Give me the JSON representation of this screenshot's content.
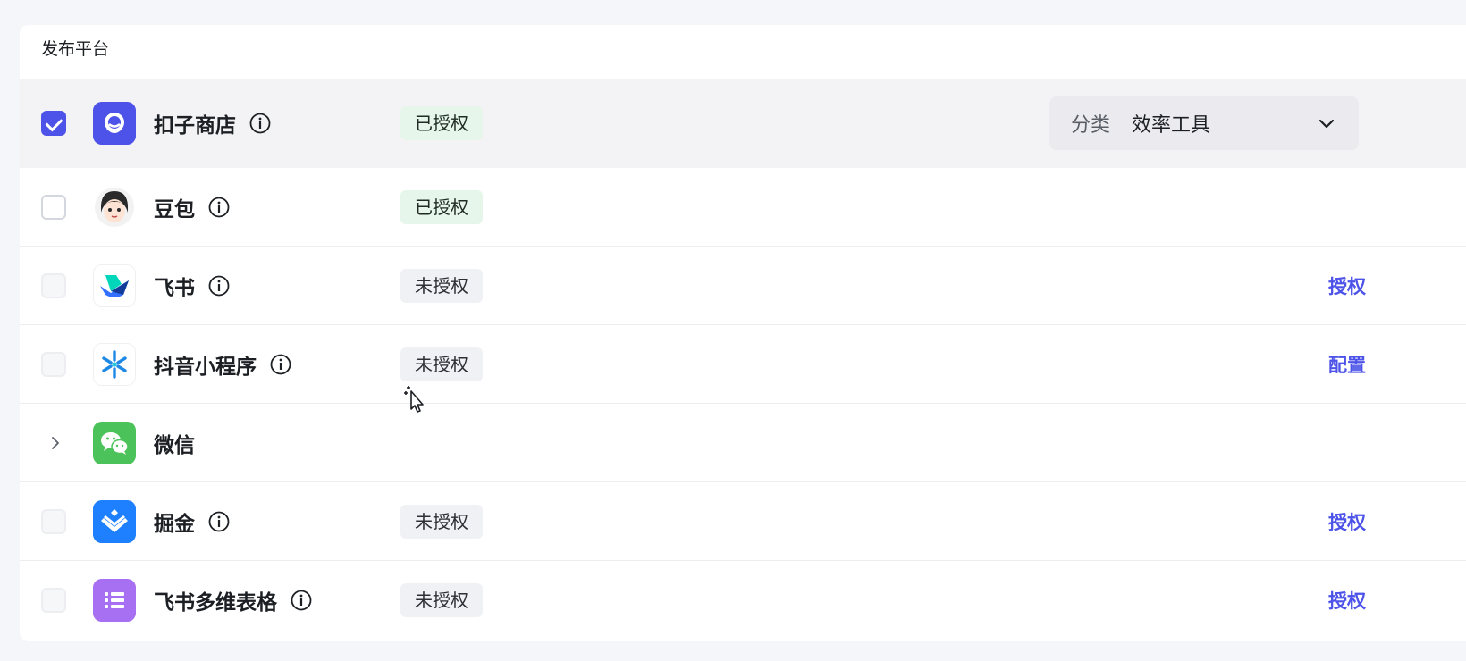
{
  "section": {
    "title": "发布平台"
  },
  "platforms": [
    {
      "name": "扣子商店",
      "icon": "coze-store-icon",
      "status": "已授权",
      "status_type": "authorized",
      "selected": true,
      "category": {
        "label": "分类",
        "value": "效率工具"
      }
    },
    {
      "name": "豆包",
      "icon": "doubao-icon",
      "status": "已授权",
      "status_type": "authorized",
      "selected": false
    },
    {
      "name": "飞书",
      "icon": "feishu-icon",
      "status": "未授权",
      "status_type": "unauthorized",
      "action": "授权"
    },
    {
      "name": "抖音小程序",
      "icon": "douyin-miniapp-icon",
      "status": "未授权",
      "status_type": "unauthorized",
      "action": "配置"
    },
    {
      "name": "微信",
      "icon": "wechat-icon",
      "expandable": true
    },
    {
      "name": "掘金",
      "icon": "juejin-icon",
      "status": "未授权",
      "status_type": "unauthorized",
      "action": "授权"
    },
    {
      "name": "飞书多维表格",
      "icon": "feishu-bitable-icon",
      "status": "未授权",
      "status_type": "unauthorized",
      "action": "授权"
    }
  ],
  "colors": {
    "accent": "#4d53e8",
    "authorized_bg": "#e6f6ea",
    "unauthorized_bg": "#f0f1f4"
  }
}
